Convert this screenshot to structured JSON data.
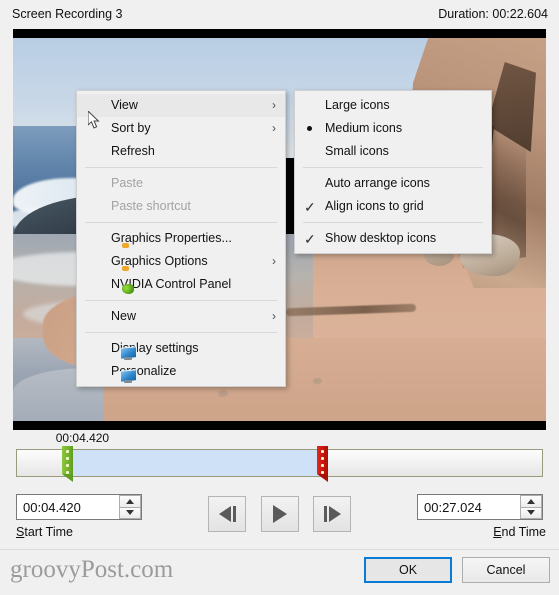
{
  "window": {
    "title": "Screen Recording 3",
    "duration_label": "Duration: 00:22.604"
  },
  "video": {
    "scene_description": "beach shoreline with ocean waves, sand and rocky cliff"
  },
  "context_menu": {
    "items": [
      {
        "label": "View",
        "submenu": true,
        "highlighted": true,
        "disabled": false,
        "icon": ""
      },
      {
        "label": "Sort by",
        "submenu": true,
        "highlighted": false,
        "disabled": false,
        "icon": ""
      },
      {
        "label": "Refresh",
        "submenu": false,
        "highlighted": false,
        "disabled": false,
        "icon": ""
      },
      {
        "separator": true
      },
      {
        "label": "Paste",
        "submenu": false,
        "highlighted": false,
        "disabled": true,
        "icon": ""
      },
      {
        "label": "Paste shortcut",
        "submenu": false,
        "highlighted": false,
        "disabled": true,
        "icon": ""
      },
      {
        "separator": true
      },
      {
        "label": "Graphics Properties...",
        "submenu": false,
        "highlighted": false,
        "disabled": false,
        "icon": "intel-graphics-icon"
      },
      {
        "label": "Graphics Options",
        "submenu": true,
        "highlighted": false,
        "disabled": false,
        "icon": "intel-graphics-icon"
      },
      {
        "label": "NVIDIA Control Panel",
        "submenu": false,
        "highlighted": false,
        "disabled": false,
        "icon": "nvidia-icon"
      },
      {
        "separator": true
      },
      {
        "label": "New",
        "submenu": true,
        "highlighted": false,
        "disabled": false,
        "icon": ""
      },
      {
        "separator": true
      },
      {
        "label": "Display settings",
        "submenu": false,
        "highlighted": false,
        "disabled": false,
        "icon": "monitor-icon"
      },
      {
        "label": "Personalize",
        "submenu": false,
        "highlighted": false,
        "disabled": false,
        "icon": "monitor-icon"
      }
    ]
  },
  "view_submenu": {
    "items": [
      {
        "label": "Large icons",
        "mark": "none"
      },
      {
        "label": "Medium icons",
        "mark": "radio"
      },
      {
        "label": "Small icons",
        "mark": "none"
      },
      {
        "separator": true
      },
      {
        "label": "Auto arrange icons",
        "mark": "none"
      },
      {
        "label": "Align icons to grid",
        "mark": "check"
      },
      {
        "separator": true
      },
      {
        "label": "Show desktop icons",
        "mark": "check"
      }
    ]
  },
  "timeline": {
    "position_label": "00:04.420",
    "start_percent": 8.9,
    "end_percent": 57.5,
    "start_handle_color": "#74b52c",
    "end_handle_color": "#c8150d",
    "selection_color": "#cfe1f7"
  },
  "controls": {
    "start_time_value": "00:04.420",
    "start_time_label_accel": "S",
    "start_time_label_rest": "tart Time",
    "end_time_value": "00:27.024",
    "end_time_label_accel": "E",
    "end_time_label_rest": "nd Time",
    "prev_frame_icon": "previous-frame-icon",
    "play_icon": "play-icon",
    "next_frame_icon": "next-frame-icon"
  },
  "footer": {
    "watermark": "groovyPost.com",
    "ok_label": "OK",
    "cancel_label": "Cancel"
  }
}
